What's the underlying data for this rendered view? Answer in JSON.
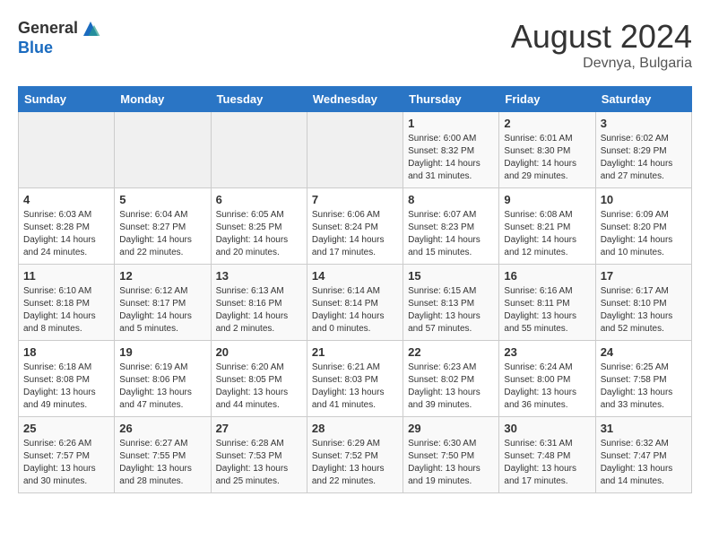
{
  "logo": {
    "general": "General",
    "blue": "Blue"
  },
  "title": "August 2024",
  "subtitle": "Devnya, Bulgaria",
  "days_of_week": [
    "Sunday",
    "Monday",
    "Tuesday",
    "Wednesday",
    "Thursday",
    "Friday",
    "Saturday"
  ],
  "weeks": [
    [
      {
        "day": "",
        "content": ""
      },
      {
        "day": "",
        "content": ""
      },
      {
        "day": "",
        "content": ""
      },
      {
        "day": "",
        "content": ""
      },
      {
        "day": "1",
        "content": "Sunrise: 6:00 AM\nSunset: 8:32 PM\nDaylight: 14 hours\nand 31 minutes."
      },
      {
        "day": "2",
        "content": "Sunrise: 6:01 AM\nSunset: 8:30 PM\nDaylight: 14 hours\nand 29 minutes."
      },
      {
        "day": "3",
        "content": "Sunrise: 6:02 AM\nSunset: 8:29 PM\nDaylight: 14 hours\nand 27 minutes."
      }
    ],
    [
      {
        "day": "4",
        "content": "Sunrise: 6:03 AM\nSunset: 8:28 PM\nDaylight: 14 hours\nand 24 minutes."
      },
      {
        "day": "5",
        "content": "Sunrise: 6:04 AM\nSunset: 8:27 PM\nDaylight: 14 hours\nand 22 minutes."
      },
      {
        "day": "6",
        "content": "Sunrise: 6:05 AM\nSunset: 8:25 PM\nDaylight: 14 hours\nand 20 minutes."
      },
      {
        "day": "7",
        "content": "Sunrise: 6:06 AM\nSunset: 8:24 PM\nDaylight: 14 hours\nand 17 minutes."
      },
      {
        "day": "8",
        "content": "Sunrise: 6:07 AM\nSunset: 8:23 PM\nDaylight: 14 hours\nand 15 minutes."
      },
      {
        "day": "9",
        "content": "Sunrise: 6:08 AM\nSunset: 8:21 PM\nDaylight: 14 hours\nand 12 minutes."
      },
      {
        "day": "10",
        "content": "Sunrise: 6:09 AM\nSunset: 8:20 PM\nDaylight: 14 hours\nand 10 minutes."
      }
    ],
    [
      {
        "day": "11",
        "content": "Sunrise: 6:10 AM\nSunset: 8:18 PM\nDaylight: 14 hours\nand 8 minutes."
      },
      {
        "day": "12",
        "content": "Sunrise: 6:12 AM\nSunset: 8:17 PM\nDaylight: 14 hours\nand 5 minutes."
      },
      {
        "day": "13",
        "content": "Sunrise: 6:13 AM\nSunset: 8:16 PM\nDaylight: 14 hours\nand 2 minutes."
      },
      {
        "day": "14",
        "content": "Sunrise: 6:14 AM\nSunset: 8:14 PM\nDaylight: 14 hours\nand 0 minutes."
      },
      {
        "day": "15",
        "content": "Sunrise: 6:15 AM\nSunset: 8:13 PM\nDaylight: 13 hours\nand 57 minutes."
      },
      {
        "day": "16",
        "content": "Sunrise: 6:16 AM\nSunset: 8:11 PM\nDaylight: 13 hours\nand 55 minutes."
      },
      {
        "day": "17",
        "content": "Sunrise: 6:17 AM\nSunset: 8:10 PM\nDaylight: 13 hours\nand 52 minutes."
      }
    ],
    [
      {
        "day": "18",
        "content": "Sunrise: 6:18 AM\nSunset: 8:08 PM\nDaylight: 13 hours\nand 49 minutes."
      },
      {
        "day": "19",
        "content": "Sunrise: 6:19 AM\nSunset: 8:06 PM\nDaylight: 13 hours\nand 47 minutes."
      },
      {
        "day": "20",
        "content": "Sunrise: 6:20 AM\nSunset: 8:05 PM\nDaylight: 13 hours\nand 44 minutes."
      },
      {
        "day": "21",
        "content": "Sunrise: 6:21 AM\nSunset: 8:03 PM\nDaylight: 13 hours\nand 41 minutes."
      },
      {
        "day": "22",
        "content": "Sunrise: 6:23 AM\nSunset: 8:02 PM\nDaylight: 13 hours\nand 39 minutes."
      },
      {
        "day": "23",
        "content": "Sunrise: 6:24 AM\nSunset: 8:00 PM\nDaylight: 13 hours\nand 36 minutes."
      },
      {
        "day": "24",
        "content": "Sunrise: 6:25 AM\nSunset: 7:58 PM\nDaylight: 13 hours\nand 33 minutes."
      }
    ],
    [
      {
        "day": "25",
        "content": "Sunrise: 6:26 AM\nSunset: 7:57 PM\nDaylight: 13 hours\nand 30 minutes."
      },
      {
        "day": "26",
        "content": "Sunrise: 6:27 AM\nSunset: 7:55 PM\nDaylight: 13 hours\nand 28 minutes."
      },
      {
        "day": "27",
        "content": "Sunrise: 6:28 AM\nSunset: 7:53 PM\nDaylight: 13 hours\nand 25 minutes."
      },
      {
        "day": "28",
        "content": "Sunrise: 6:29 AM\nSunset: 7:52 PM\nDaylight: 13 hours\nand 22 minutes."
      },
      {
        "day": "29",
        "content": "Sunrise: 6:30 AM\nSunset: 7:50 PM\nDaylight: 13 hours\nand 19 minutes."
      },
      {
        "day": "30",
        "content": "Sunrise: 6:31 AM\nSunset: 7:48 PM\nDaylight: 13 hours\nand 17 minutes."
      },
      {
        "day": "31",
        "content": "Sunrise: 6:32 AM\nSunset: 7:47 PM\nDaylight: 13 hours\nand 14 minutes."
      }
    ]
  ]
}
